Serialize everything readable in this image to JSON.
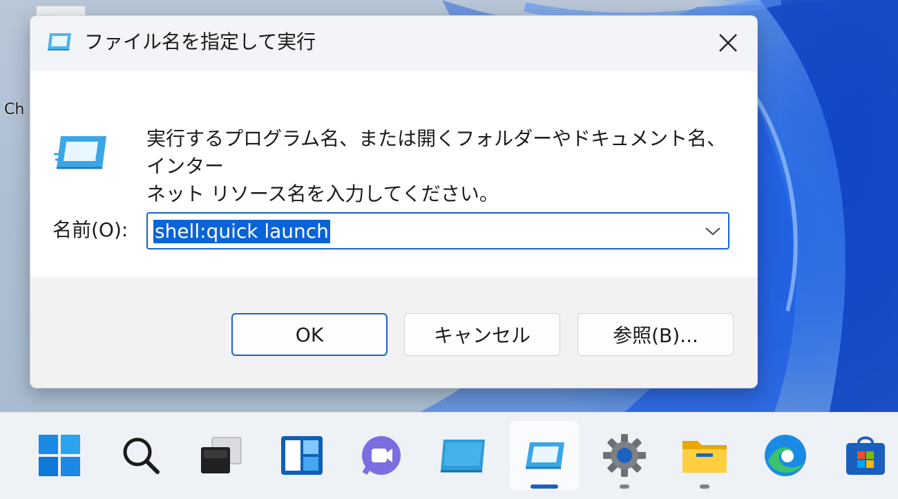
{
  "desktop": {
    "icon_label": "Ch"
  },
  "dialog": {
    "title": "ファイル名を指定して実行",
    "description_line1": "実行するプログラム名、または開くフォルダーやドキュメント名、インター",
    "description_line2": "ネット リソース名を入力してください。",
    "name_label": "名前(O):",
    "name_value": "shell:quick launch",
    "buttons": {
      "ok": "OK",
      "cancel": "キャンセル",
      "browse": "参照(B)..."
    }
  },
  "taskbar": {
    "items": [
      {
        "name": "start",
        "icon": "windows-start-icon",
        "active": false,
        "indicator": "none"
      },
      {
        "name": "search",
        "icon": "search-icon",
        "active": false,
        "indicator": "none"
      },
      {
        "name": "task-view",
        "icon": "task-view-icon",
        "active": false,
        "indicator": "none"
      },
      {
        "name": "widgets",
        "icon": "widgets-icon",
        "active": false,
        "indicator": "none"
      },
      {
        "name": "teams-chat",
        "icon": "video-chat-icon",
        "active": false,
        "indicator": "none"
      },
      {
        "name": "desktop",
        "icon": "monitor-icon",
        "active": false,
        "indicator": "none"
      },
      {
        "name": "run",
        "icon": "run-dialog-icon",
        "active": true,
        "indicator": "active"
      },
      {
        "name": "settings",
        "icon": "gear-icon",
        "active": false,
        "indicator": "open"
      },
      {
        "name": "file-explorer",
        "icon": "folder-icon",
        "active": false,
        "indicator": "open"
      },
      {
        "name": "edge",
        "icon": "edge-browser-icon",
        "active": false,
        "indicator": "none"
      },
      {
        "name": "store",
        "icon": "store-icon",
        "active": false,
        "indicator": "none"
      }
    ]
  },
  "colors": {
    "accent": "#1a62c4",
    "selection": "#0a64d8"
  }
}
